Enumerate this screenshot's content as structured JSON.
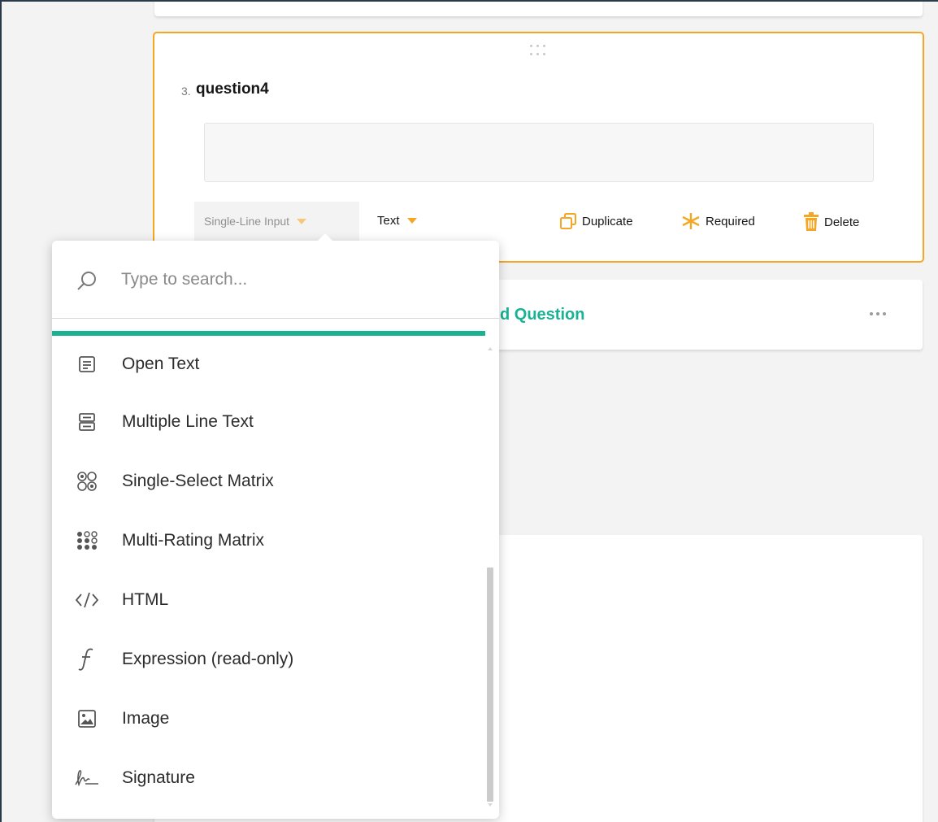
{
  "question": {
    "number": "3.",
    "title": "question4",
    "type_label": "Single-Line Input",
    "subtype_label": "Text",
    "actions": {
      "duplicate": "Duplicate",
      "required": "Required",
      "delete": "Delete"
    }
  },
  "add_question": {
    "label_visible": "d Question"
  },
  "dropdown": {
    "search_placeholder": "Type to search...",
    "items": [
      {
        "label": "Open Text",
        "icon": "open-text-icon"
      },
      {
        "label": "Multiple Line Text",
        "icon": "multiple-text-icon"
      },
      {
        "label": "Single-Select Matrix",
        "icon": "matrix-icon"
      },
      {
        "label": "Multi-Rating Matrix",
        "icon": "rating-matrix-icon"
      },
      {
        "label": "HTML",
        "icon": "code-icon"
      },
      {
        "label": "Expression (read-only)",
        "icon": "function-icon"
      },
      {
        "label": "Image",
        "icon": "image-icon"
      },
      {
        "label": "Signature",
        "icon": "signature-icon"
      }
    ]
  },
  "colors": {
    "accent_orange": "#f5a623",
    "accent_green": "#19b394",
    "background": "#f3f3f3"
  }
}
